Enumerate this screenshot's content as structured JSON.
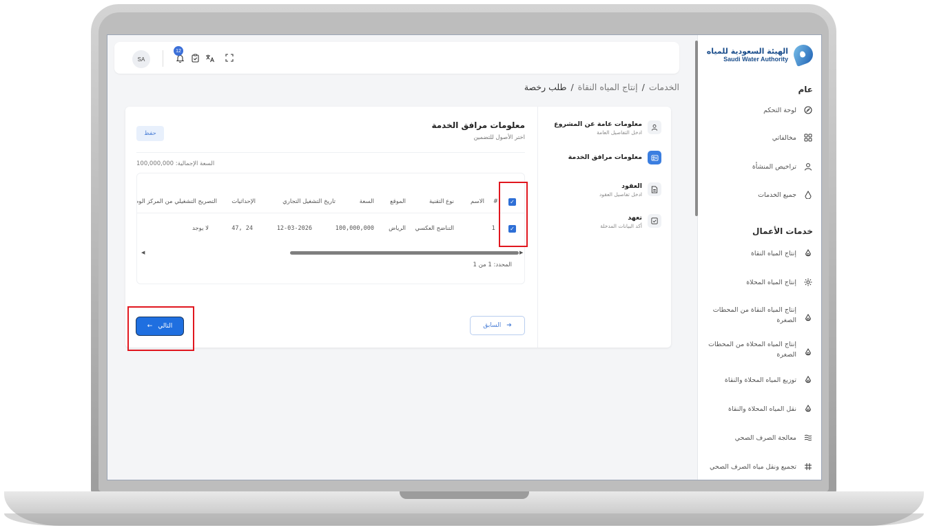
{
  "brand": {
    "name_ar": "الهيئة السعودية للمياه",
    "name_en": "Saudi Water Authority"
  },
  "sidebar": {
    "section_general": "عام",
    "general_items": [
      {
        "label": "لوحة التحكم",
        "icon": "compass-icon"
      },
      {
        "label": "مخالفاتي",
        "icon": "grid-icon"
      },
      {
        "label": "تراخيص المنشأة",
        "icon": "user-icon"
      },
      {
        "label": "جميع الخدمات",
        "icon": "drop-icon"
      }
    ],
    "section_business": "خدمات الأعمال",
    "business_items": [
      {
        "label": "إنتاج المياه النقاة",
        "icon": "water-drop-icon"
      },
      {
        "label": "إنتاج المياه المحلاة",
        "icon": "sun-icon"
      },
      {
        "label": "إنتاج المياه النقاة من المحطات الصغرة",
        "icon": "water-drop-icon"
      },
      {
        "label": "إنتاج المياه المحلاة من المحطات الصغرة",
        "icon": "water-drop-icon"
      },
      {
        "label": "توزيع المياه المحلاة والنقاة",
        "icon": "water-drop-icon"
      },
      {
        "label": "نقل المياه المحلاة والنقاة",
        "icon": "water-drop-icon"
      },
      {
        "label": "معالجة الصرف الصحي",
        "icon": "waves-icon"
      },
      {
        "label": "تجميع ونقل مياه الصرف الصحي",
        "icon": "hash-grid-icon"
      }
    ]
  },
  "topbar": {
    "avatar": "SA",
    "notification_count": "12"
  },
  "breadcrumb": {
    "root": "الخدمات",
    "sep": "/",
    "middle": "إنتاج المياه النقاة",
    "current": "طلب رخصة"
  },
  "steps": [
    {
      "title": "معلومات عامة عن المشروع",
      "subtitle": "ادخل التفاصيل العامة"
    },
    {
      "title": "معلومات مرافق الخدمة",
      "subtitle": ""
    },
    {
      "title": "العقود",
      "subtitle": "ادخل تفاصيل العقود"
    },
    {
      "title": "تعهد",
      "subtitle": "أكد البيانات المدخلة"
    }
  ],
  "content": {
    "title": "معلومات مرافق الخدمة",
    "subtitle": "اختر الأصول للتضمين",
    "save_label": "حفظ",
    "capacity_total": "السعة الإجمالية: 100,000,000",
    "selected_text": "المحدد: 1 من 1"
  },
  "table": {
    "headers": {
      "index": "#",
      "name": "الاسم",
      "technology": "نوع التقنية",
      "location": "الموقع",
      "capacity": "السعة",
      "operation_date": "تاريخ التشغيل التجاري",
      "coordinates": "الإحداثيات",
      "permit": "التصريح التشغيلي من المركز الوطني للرقا"
    },
    "row": {
      "index": "1",
      "name": "",
      "technology": "التناضح العكسي",
      "location": "الرياض",
      "capacity": "100,000,000",
      "operation_date": "12-03-2026",
      "coordinates": "24 ,47",
      "permit": "لا يوجد"
    }
  },
  "nav": {
    "prev_label": "السابق",
    "next_label": "التالي",
    "prev_arrow": "➔",
    "next_arrow": "←"
  },
  "colors": {
    "primary": "#1f6fe0",
    "highlight": "#e0161e",
    "brand": "#1b4e8c"
  }
}
